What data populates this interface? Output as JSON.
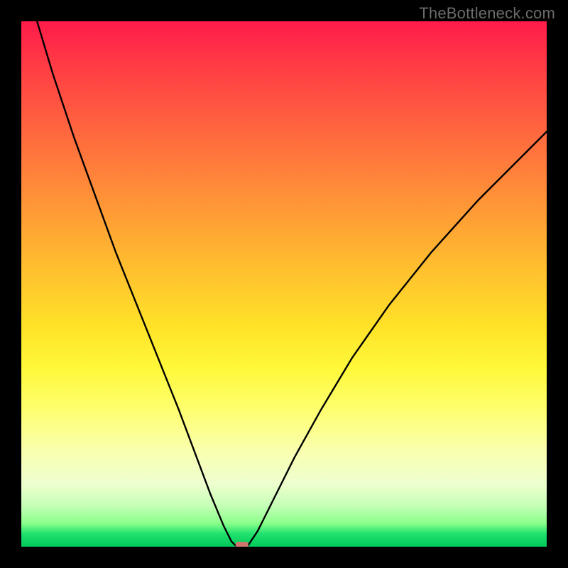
{
  "watermark": "TheBottleneck.com",
  "chart_data": {
    "type": "line",
    "title": "",
    "xlabel": "",
    "ylabel": "",
    "xlim": [
      0,
      100
    ],
    "ylim": [
      0,
      100
    ],
    "grid": false,
    "legend": false,
    "background_gradient": {
      "direction": "vertical",
      "stops": [
        {
          "pos": 0,
          "color": "#ff1b4a"
        },
        {
          "pos": 22,
          "color": "#ff6a3e"
        },
        {
          "pos": 48,
          "color": "#ffc22e"
        },
        {
          "pos": 66,
          "color": "#fff83a"
        },
        {
          "pos": 88,
          "color": "#eeffcf"
        },
        {
          "pos": 100,
          "color": "#00c95a"
        }
      ]
    },
    "series": [
      {
        "name": "left-branch",
        "x": [
          3,
          6,
          10,
          14,
          18,
          22,
          26,
          30,
          33,
          36,
          38.5,
          40,
          41
        ],
        "y": [
          100,
          90,
          78,
          67,
          56,
          46,
          36,
          26,
          18,
          10,
          4,
          1,
          0
        ]
      },
      {
        "name": "right-branch",
        "x": [
          43,
          45,
          48,
          52,
          57,
          63,
          70,
          78,
          87,
          97,
          100
        ],
        "y": [
          0,
          3,
          9,
          17,
          26,
          36,
          46,
          56,
          66,
          76,
          79
        ]
      }
    ],
    "marker": {
      "name": "minimum-point",
      "x": 42,
      "y": 0,
      "color": "#d0766f",
      "shape": "rounded-rect"
    }
  }
}
